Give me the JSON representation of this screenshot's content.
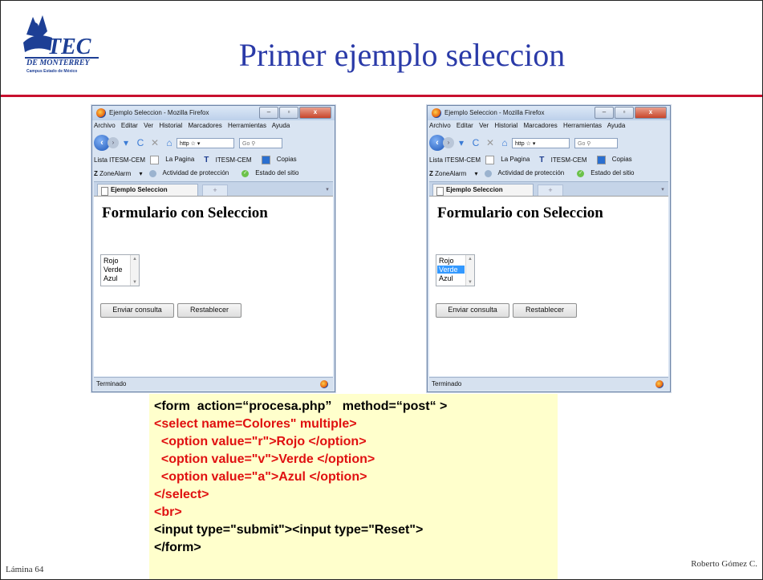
{
  "slide": {
    "title": "Primer ejemplo seleccion",
    "footer_left": "Lámina 64",
    "footer_right": "Roberto Gómez C.",
    "logo": {
      "text": "TEC",
      "sub1": "DE MONTERREY",
      "sub2": "Campus Estado de México"
    }
  },
  "browser": {
    "window_title": "Ejemplo Seleccion - Mozilla Firefox",
    "menu": [
      "Archivo",
      "Editar",
      "Ver",
      "Historial",
      "Marcadores",
      "Herramientas",
      "Ayuda"
    ],
    "url_text": "http",
    "search_text": "Go",
    "bookmarks": [
      "Lista ITESM-CEM",
      "La Pagina",
      "ITESM-CEM",
      "Copias"
    ],
    "zonealarm": [
      "ZoneAlarm",
      "Actividad de protección",
      "Estado del sitio"
    ],
    "tab_label": "Ejemplo Seleccion",
    "new_tab": "+",
    "page_heading": "Formulario con Seleccion",
    "options": [
      "Rojo",
      "Verde",
      "Azul"
    ],
    "submit_label": "Enviar consulta",
    "reset_label": "Restablecer",
    "status": "Terminado"
  },
  "windows": [
    {
      "selected_option": null
    },
    {
      "selected_option": "Verde"
    }
  ],
  "code_lines": [
    {
      "text": "<form  action=“procesa.php”   method=“post“ >",
      "color": "#000000"
    },
    {
      "text": "<select name=Colores\" multiple>",
      "color": "#e01010"
    },
    {
      "text": "  <option value=\"r\">Rojo </option>",
      "color": "#e01010"
    },
    {
      "text": "  <option value=\"v\">Verde </option>",
      "color": "#e01010"
    },
    {
      "text": "  <option value=\"a\">Azul </option>",
      "color": "#e01010"
    },
    {
      "text": "</select>",
      "color": "#e01010"
    },
    {
      "text": "<br>",
      "color": "#e01010"
    },
    {
      "text": "<input type=\"submit\"><input type=\"Reset\">",
      "color": "#000000"
    },
    {
      "text": "</form>",
      "color": "#000000"
    }
  ]
}
